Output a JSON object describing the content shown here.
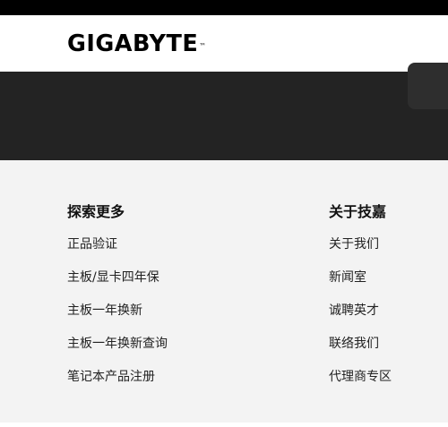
{
  "brand": {
    "logo_text": "GIGABYTE",
    "trademark": "™"
  },
  "colors": {
    "topbar": "#000000",
    "header_bg": "#ffffff",
    "dark_band": "#232323",
    "footer_bg": "#f3f3f3",
    "text": "#222222"
  },
  "footer": {
    "columns": [
      {
        "title": "探索更多",
        "links": [
          "正品验证",
          "主板/显卡四年保",
          "主板一年换新",
          "主板一年换新查询",
          "笔记本产品注册"
        ]
      },
      {
        "title": "关于技嘉",
        "links": [
          "关于我们",
          "新闻室",
          "诚聘英才",
          "联络我们",
          "代理商专区"
        ]
      }
    ]
  }
}
